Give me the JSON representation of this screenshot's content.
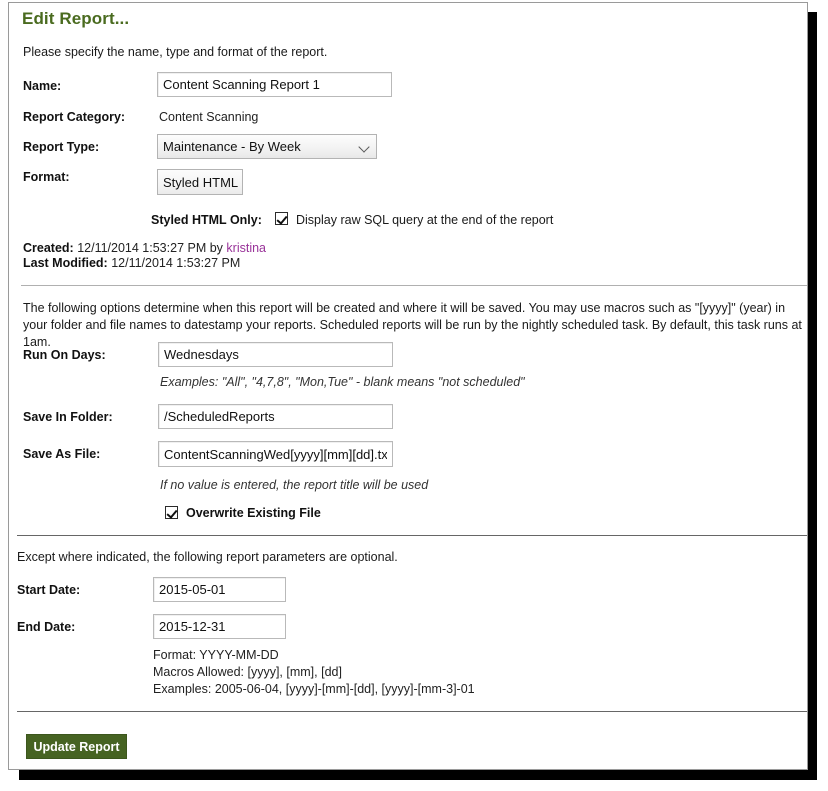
{
  "window": {
    "title": "Edit Report..."
  },
  "intro": "Please specify the name, type and format of the report.",
  "form": {
    "name": {
      "label": "Name:",
      "value": "Content Scanning Report 1"
    },
    "report_category": {
      "label": "Report Category:",
      "value": "Content Scanning"
    },
    "report_type": {
      "label": "Report Type:",
      "value": "Maintenance - By Week",
      "options": [
        "Maintenance - By Week"
      ],
      "arrow_icon": "chevron-down-icon"
    },
    "format": {
      "label": "Format:",
      "value": "Styled HTML",
      "options": [
        "Styled HTML"
      ]
    },
    "styled_html_only": {
      "label": "Styled HTML Only:",
      "checkbox_label": "Display raw SQL query at the end of the report",
      "checked": true
    }
  },
  "meta": {
    "created_label": "Created:",
    "created_value": "12/11/2014 1:53:27 PM by",
    "created_user": "kristina",
    "modified_label": "Last Modified:",
    "modified_value": "12/11/2014 1:53:27 PM"
  },
  "schedule": {
    "description": "The following options determine when this report will be created and where it will be saved. You may use macros such as \"[yyyy]\" (year) in your folder and file names to datestamp your reports. Scheduled reports will be run by the nightly scheduled task. By default, this task runs at 1am.",
    "run_on_days": {
      "label": "Run On Days:",
      "value": "Wednesdays",
      "hint": "Examples: \"All\", \"4,7,8\", \"Mon,Tue\" - blank means \"not scheduled\""
    },
    "save_in_folder": {
      "label": "Save In Folder:",
      "value": "/ScheduledReports"
    },
    "save_as_file": {
      "label": "Save As File:",
      "value": "ContentScanningWed[yyyy][mm][dd].txt",
      "hint": "If no value is entered, the report title will be used"
    },
    "overwrite": {
      "label": "Overwrite Existing File",
      "checked": true
    }
  },
  "parameters": {
    "description": "Except where indicated, the following report parameters are optional.",
    "start_date": {
      "label": "Start Date:",
      "value": "2015-05-01"
    },
    "end_date": {
      "label": "End Date:",
      "value": "2015-12-31"
    },
    "notes": "Format: YYYY-MM-DD\nMacros Allowed: [yyyy], [mm], [dd]\nExamples: 2005-06-04, [yyyy]-[mm]-[dd], [yyyy]-[mm-3]-01"
  },
  "actions": {
    "update_label": "Update Report"
  },
  "colors": {
    "title_green": "#4a6b1f",
    "button_green": "#466322",
    "link_purple": "#993399"
  }
}
